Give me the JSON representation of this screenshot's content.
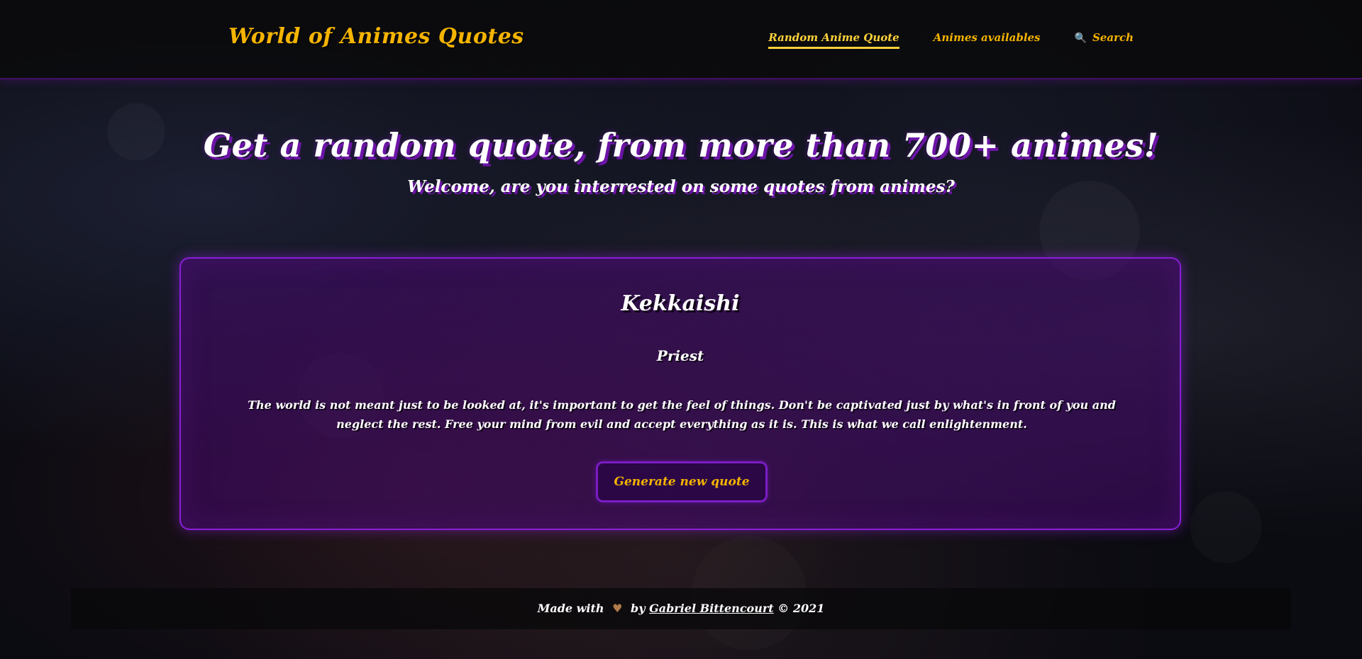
{
  "brand": {
    "title": "World of Animes Quotes"
  },
  "nav": {
    "items": [
      {
        "label": "Random Anime Quote",
        "active": true
      },
      {
        "label": "Animes availables",
        "active": false
      },
      {
        "label": "Search",
        "icon": "search-icon",
        "active": false
      }
    ]
  },
  "hero": {
    "title": "Get a random quote, from more than 700+ animes!",
    "subtitle": "Welcome, are you interrested on some quotes from animes?"
  },
  "quote": {
    "anime": "Kekkaishi",
    "character": "Priest",
    "text": "The world is not meant just to be looked at, it's important to get the feel of things. Don't be captivated just by what's in front of you and neglect the rest. Free your mind from evil and accept everything as it is. This is what we call enlightenment.",
    "button_label": "Generate new quote"
  },
  "footer": {
    "prefix": "Made with",
    "heart": "♥",
    "by": "by",
    "author": "Gabriel Bittencourt",
    "suffix": "© 2021"
  },
  "colors": {
    "accent": "#f5b400",
    "purple": "#8a1fd6",
    "shadow_purple": "#6d14a8"
  }
}
